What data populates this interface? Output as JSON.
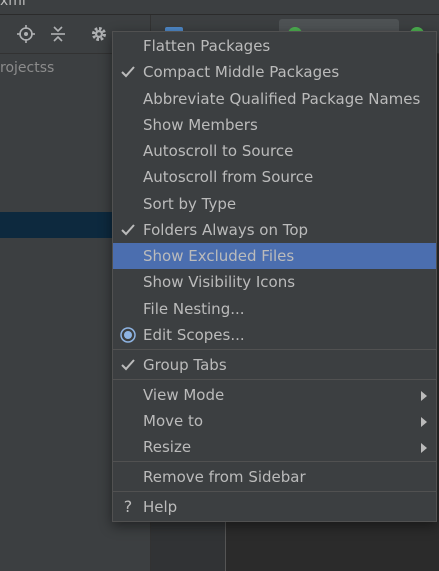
{
  "window": {
    "title_fragment": "xml"
  },
  "project_tree": {
    "visible_text": "rojectss"
  },
  "menu": {
    "items": [
      {
        "label": "Flatten Packages",
        "checked": false
      },
      {
        "label": "Compact Middle Packages",
        "checked": true
      },
      {
        "label": "Abbreviate Qualified Package Names",
        "checked": false
      },
      {
        "label": "Show Members",
        "checked": false
      },
      {
        "label": "Autoscroll to Source",
        "checked": false
      },
      {
        "label": "Autoscroll from Source",
        "checked": false
      },
      {
        "label": "Sort by Type",
        "checked": false
      },
      {
        "label": "Folders Always on Top",
        "checked": true
      },
      {
        "label": "Show Excluded Files",
        "checked": false,
        "highlighted": true
      },
      {
        "label": "Show Visibility Icons",
        "checked": false
      },
      {
        "label": "File Nesting...",
        "checked": false
      },
      {
        "label": "Edit Scopes...",
        "icon": "radio-icon"
      },
      {
        "label": "Group Tabs",
        "checked": true
      },
      {
        "label": "View Mode",
        "submenu": true
      },
      {
        "label": "Move to",
        "submenu": true
      },
      {
        "label": "Resize",
        "submenu": true
      },
      {
        "label": "Remove from Sidebar"
      },
      {
        "label": "Help",
        "icon": "question-icon"
      }
    ]
  },
  "colors": {
    "menu_bg": "#3c3f41",
    "highlight": "#4b6eaf",
    "text": "#bbbbbb"
  }
}
